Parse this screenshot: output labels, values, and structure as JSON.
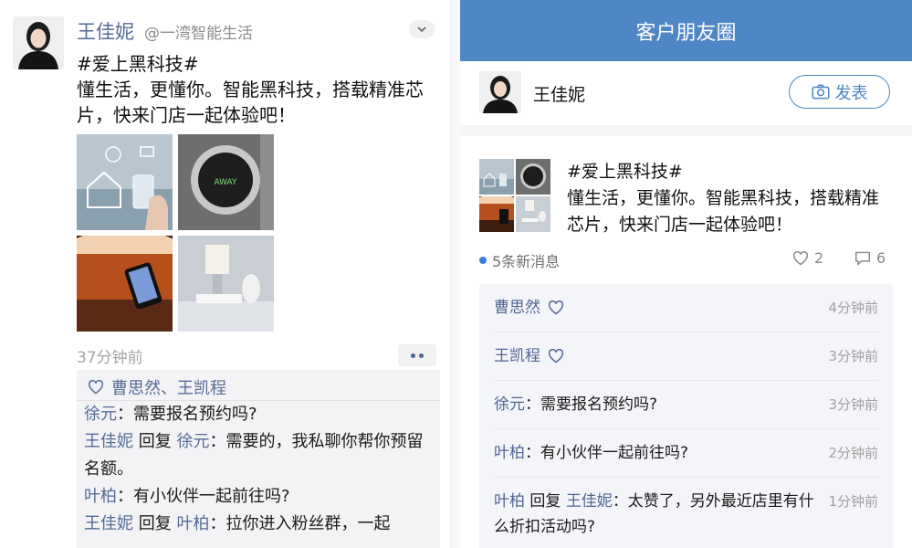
{
  "left": {
    "author": {
      "name": "王佳妮",
      "handle": "@一湾智能生活"
    },
    "post_text_hashtag": "#爱上黑科技#",
    "post_text_body": "懂生活，更懂你。智能黑科技，搭载精准芯片，快来门店一起体验吧！",
    "time": "37分钟前",
    "likers": "曹思然、王凯程",
    "comments": [
      {
        "from": "徐元",
        "text": "：需要报名预约吗?"
      },
      {
        "from": "王佳妮",
        "reply_word": "回复",
        "to": "徐元",
        "text": "：需要的，我私聊你帮你预留名额。"
      },
      {
        "from": "叶柏",
        "text": "：有小伙伴一起前往吗?"
      },
      {
        "from": "王佳妮",
        "reply_word": "回复",
        "to": "叶柏",
        "text": "：拉你进入粉丝群，一起"
      }
    ]
  },
  "right": {
    "header_title": "客户朋友圈",
    "user_name": "王佳妮",
    "post_button_label": "发表",
    "post_text_hashtag": "#爱上黑科技#",
    "post_text_body": "懂生活，更懂你。智能黑科技，搭载精准芯片，快来门店一起体验吧！",
    "new_messages": "5条新消息",
    "like_count": "2",
    "comment_count": "6",
    "comments": [
      {
        "name": "曹思然",
        "type": "like",
        "time": "4分钟前"
      },
      {
        "name": "王凯程",
        "type": "like",
        "time": "3分钟前"
      },
      {
        "name": "徐元",
        "text": "：需要报名预约吗?",
        "time": "3分钟前"
      },
      {
        "name": "叶柏",
        "text": "：有小伙伴一起前往吗?",
        "time": "2分钟前"
      },
      {
        "name": "叶柏",
        "reply_word": "回复",
        "to": "王佳妮",
        "text": "：太赞了，另外最近店里有什么折扣活动吗?",
        "time": "1分钟前"
      }
    ]
  },
  "icons": {
    "heart": "heart-icon",
    "comment": "comment-icon",
    "camera": "camera-icon",
    "chevron": "chevron-down-icon",
    "more": "more-icon"
  },
  "colors": {
    "accent": "#4f86c6",
    "name_link": "#556b95",
    "unread_dot": "#3d7fe0"
  }
}
